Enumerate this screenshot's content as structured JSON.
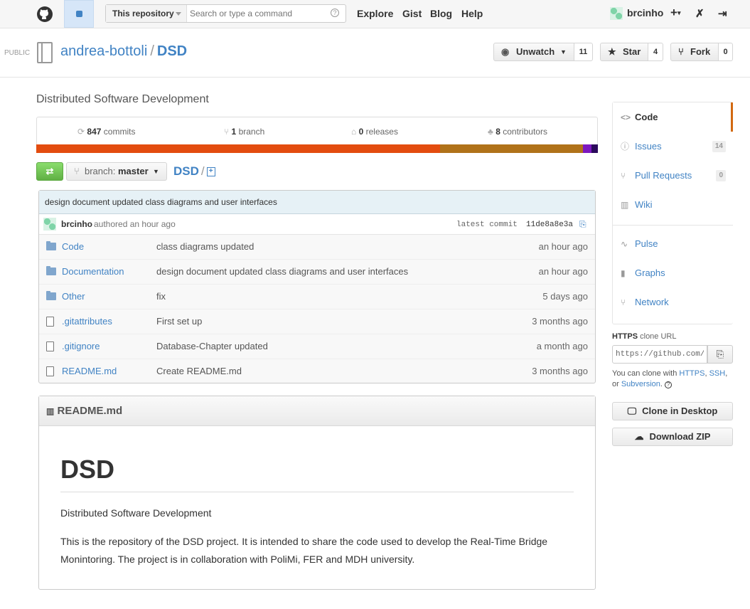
{
  "header": {
    "scope_label": "This repository",
    "search_placeholder": "Search or type a command",
    "nav": [
      "Explore",
      "Gist",
      "Blog",
      "Help"
    ],
    "username": "brcinho",
    "plus_label": "+"
  },
  "repo": {
    "visibility": "PUBLIC",
    "owner": "andrea-bottoli",
    "separator": "/",
    "name": "DSD",
    "description": "Distributed Software Development",
    "watch_label": "Unwatch",
    "watch_count": "11",
    "star_label": "Star",
    "star_count": "4",
    "fork_label": "Fork",
    "fork_count": "0"
  },
  "stats": {
    "commits_num": "847",
    "commits_label": "commits",
    "branch_num": "1",
    "branch_label": "branch",
    "releases_num": "0",
    "releases_label": "releases",
    "contributors_num": "8",
    "contributors_label": "contributors"
  },
  "language_bar": [
    {
      "color": "#e34c0f",
      "fraction": 0.719
    },
    {
      "color": "#b07219",
      "fraction": 0.255
    },
    {
      "color": "#7c18bf",
      "fraction": 0.014
    },
    {
      "color": "#2b0a5c",
      "fraction": 0.012
    }
  ],
  "branch": {
    "prefix": "branch:",
    "name": "master"
  },
  "path": {
    "root": "DSD",
    "slash": "/"
  },
  "commit": {
    "message": "design document updated class diagrams and user interfaces",
    "author": "brcinho",
    "authored": "authored an hour ago",
    "latest_label": "latest commit",
    "sha": "11de8a8e3a"
  },
  "files": [
    {
      "type": "folder",
      "name": "Code",
      "message": "class diagrams updated",
      "age": "an hour ago"
    },
    {
      "type": "folder",
      "name": "Documentation",
      "message": "design document updated class diagrams and user interfaces",
      "age": "an hour ago"
    },
    {
      "type": "folder",
      "name": "Other",
      "message": "fix",
      "age": "5 days ago"
    },
    {
      "type": "file",
      "name": ".gitattributes",
      "message": "First set up",
      "age": "3 months ago"
    },
    {
      "type": "file",
      "name": ".gitignore",
      "message": "Database-Chapter updated",
      "age": "a month ago"
    },
    {
      "type": "file",
      "name": "README.md",
      "message": "Create README.md",
      "age": "3 months ago"
    }
  ],
  "readme": {
    "filename": "README.md",
    "heading": "DSD",
    "para1": "Distributed Software Development",
    "para2": "This is the repository of the DSD project. It is intended to share the code used to develop the Real-Time Bridge Monintoring. The project is in collaboration with PoliMi, FER and MDH university."
  },
  "sidebar": {
    "items": [
      {
        "label": "Code",
        "icon": "code-icon"
      },
      {
        "label": "Issues",
        "icon": "issue-icon",
        "badge": "14"
      },
      {
        "label": "Pull Requests",
        "icon": "pull-request-icon",
        "badge": "0"
      },
      {
        "label": "Wiki",
        "icon": "book-icon"
      },
      {
        "label": "Pulse",
        "icon": "pulse-icon"
      },
      {
        "label": "Graphs",
        "icon": "graph-icon"
      },
      {
        "label": "Network",
        "icon": "network-icon"
      }
    ],
    "clone_protocol": "HTTPS",
    "clone_suffix": "clone URL",
    "clone_url": "https://github.com/andrea-bottoli/DSD.git",
    "clone_help_pre": "You can clone with",
    "clone_https": "HTTPS",
    "clone_ssh": "SSH",
    "clone_or": "or",
    "clone_svn": "Subversion",
    "clone_desktop": "Clone in Desktop",
    "download_zip": "Download ZIP"
  }
}
